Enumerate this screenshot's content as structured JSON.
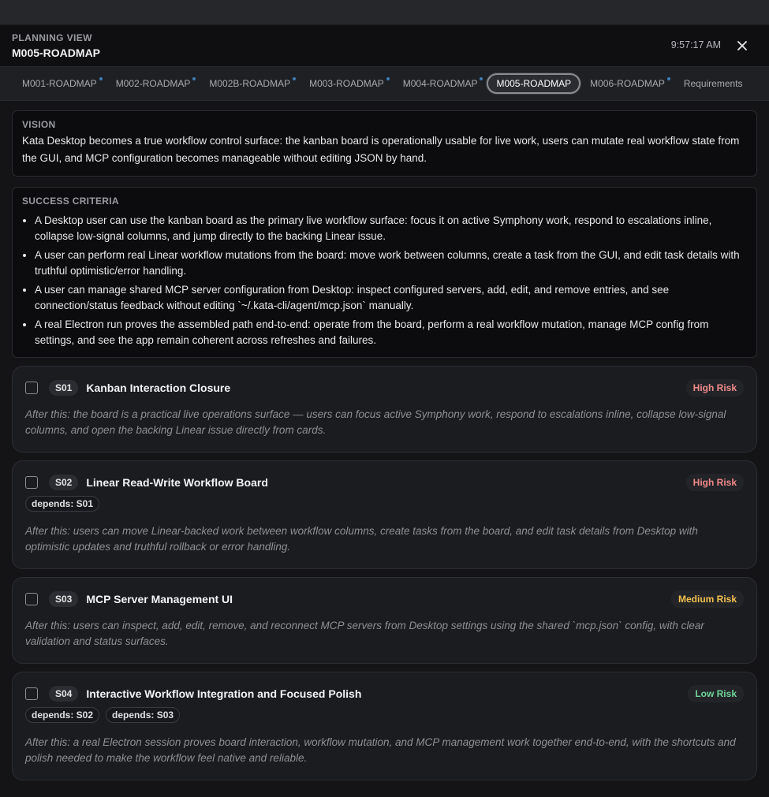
{
  "header": {
    "eyebrow": "PLANNING VIEW",
    "title": "M005-ROADMAP",
    "time": "9:57:17 AM"
  },
  "tabs": [
    {
      "label": "M001-ROADMAP",
      "dot": true,
      "active": false
    },
    {
      "label": "M002-ROADMAP",
      "dot": true,
      "active": false
    },
    {
      "label": "M002B-ROADMAP",
      "dot": true,
      "active": false
    },
    {
      "label": "M003-ROADMAP",
      "dot": true,
      "active": false
    },
    {
      "label": "M004-ROADMAP",
      "dot": true,
      "active": false
    },
    {
      "label": "M005-ROADMAP",
      "dot": false,
      "active": true
    },
    {
      "label": "M006-ROADMAP",
      "dot": true,
      "active": false
    },
    {
      "label": "Requirements",
      "dot": false,
      "active": false
    }
  ],
  "vision": {
    "label": "VISION",
    "text": "Kata Desktop becomes a true workflow control surface: the kanban board is operationally usable for live work, users can mutate real workflow state from the GUI, and MCP configuration becomes manageable without editing JSON by hand."
  },
  "success": {
    "label": "SUCCESS CRITERIA",
    "items": [
      "A Desktop user can use the kanban board as the primary live workflow surface: focus it on active Symphony work, respond to escalations inline, collapse low-signal columns, and jump directly to the backing Linear issue.",
      "A user can perform real Linear workflow mutations from the board: move work between columns, create a task from the GUI, and edit task details with truthful optimistic/error handling.",
      "A user can manage shared MCP server configuration from Desktop: inspect configured servers, add, edit, and remove entries, and see connection/status feedback without editing `~/.kata-cli/agent/mcp.json` manually.",
      "A real Electron run proves the assembled path end-to-end: operate from the board, perform a real workflow mutation, manage MCP config from settings, and see the app remain coherent across refreshes and failures."
    ]
  },
  "colors": {
    "high_risk": "#f08a8a",
    "medium_risk": "#f2c14e",
    "low_risk": "#6fd49a"
  },
  "slices": [
    {
      "id": "S01",
      "title": "Kanban Interaction Closure",
      "risk": "High Risk",
      "risk_level": "high",
      "depends": [],
      "after": "After this: the board is a practical live operations surface — users can focus active Symphony work, respond to escalations inline, collapse low-signal columns, and open the backing Linear issue directly from cards."
    },
    {
      "id": "S02",
      "title": "Linear Read-Write Workflow Board",
      "risk": "High Risk",
      "risk_level": "high",
      "depends": [
        "depends: S01"
      ],
      "after": "After this: users can move Linear-backed work between workflow columns, create tasks from the board, and edit task details from Desktop with optimistic updates and truthful rollback or error handling."
    },
    {
      "id": "S03",
      "title": "MCP Server Management UI",
      "risk": "Medium Risk",
      "risk_level": "medium",
      "depends": [],
      "after": "After this: users can inspect, add, edit, remove, and reconnect MCP servers from Desktop settings using the shared `mcp.json` config, with clear validation and status surfaces."
    },
    {
      "id": "S04",
      "title": "Interactive Workflow Integration and Focused Polish",
      "risk": "Low Risk",
      "risk_level": "low",
      "depends": [
        "depends: S02",
        "depends: S03"
      ],
      "after": "After this: a real Electron session proves board interaction, workflow mutation, and MCP management work together end-to-end, with the shortcuts and polish needed to make the workflow feel native and reliable."
    }
  ]
}
